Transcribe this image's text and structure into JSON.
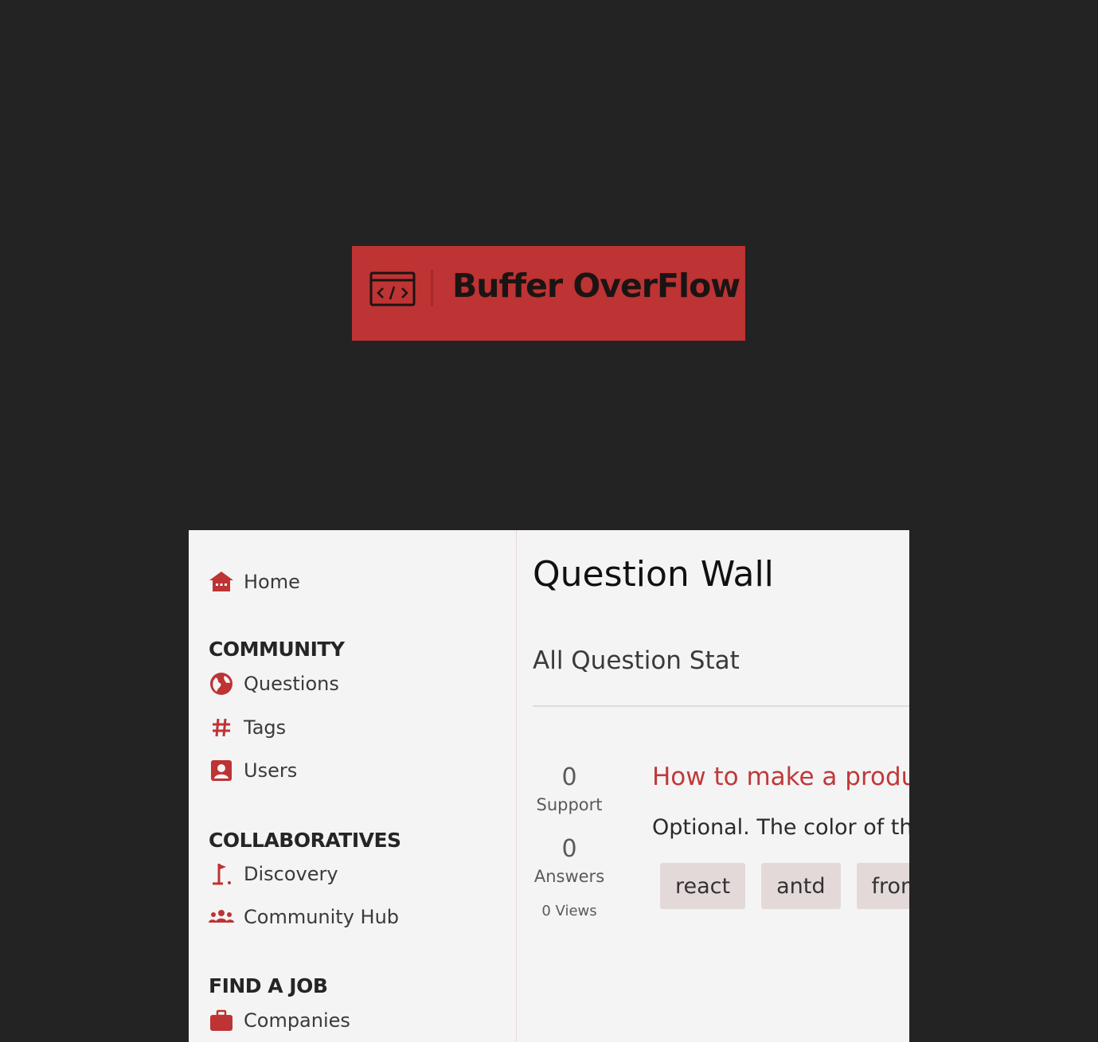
{
  "logo": {
    "text": "Buffer OverFlow"
  },
  "colors": {
    "accent": "#be3333",
    "link": "#c0393b",
    "background": "#232323",
    "panel": "#f4f4f4"
  },
  "sidebar": {
    "home": {
      "label": "Home",
      "icon": "home-icon"
    },
    "sections": [
      {
        "title": "COMMUNITY",
        "items": [
          {
            "label": "Questions",
            "icon": "globe-icon"
          },
          {
            "label": "Tags",
            "icon": "hash-icon"
          },
          {
            "label": "Users",
            "icon": "user-card-icon"
          }
        ]
      },
      {
        "title": "COLLABORATIVES",
        "items": [
          {
            "label": "Discovery",
            "icon": "flag-icon"
          },
          {
            "label": "Community Hub",
            "icon": "users-icon"
          }
        ]
      },
      {
        "title": "FIND A JOB",
        "items": [
          {
            "label": "Companies",
            "icon": "briefcase-icon"
          }
        ]
      }
    ]
  },
  "main": {
    "title": "Question Wall",
    "subtitle": "All Question Stat",
    "question": {
      "support_count": "0",
      "support_label": "Support",
      "answers_count": "0",
      "answers_label": "Answers",
      "views": "0 Views",
      "title": "How to make a produ",
      "description": "Optional. The color of th",
      "tags": [
        "react",
        "antd",
        "fron"
      ]
    }
  }
}
